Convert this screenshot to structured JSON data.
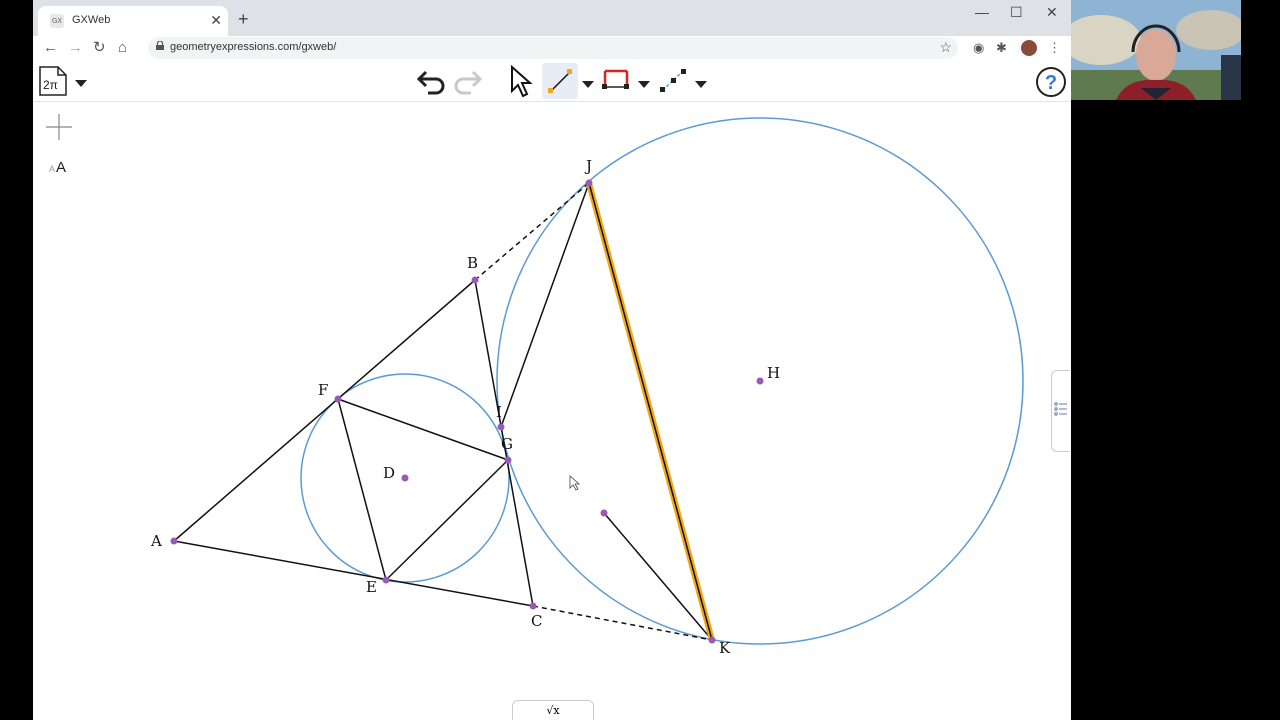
{
  "browser": {
    "tab_title": "GXWeb",
    "tab_favicon_text": "GX",
    "url": "geometryexpressions.com/gxweb/"
  },
  "app": {
    "doc_button_label": "2π",
    "left_tools": [
      "+",
      "AA"
    ]
  },
  "geometry": {
    "point_labels": {
      "A": "A",
      "B": "B",
      "C": "C",
      "D": "D",
      "E": "E",
      "F": "F",
      "G": "G",
      "H": "H",
      "I": "I",
      "J": "J",
      "K": "K"
    },
    "highlight_color": "#f2a71a",
    "circle_color": "#5b9bd5",
    "point_color": "#9b59b6"
  },
  "bottom_panel": {
    "label": "√x"
  }
}
